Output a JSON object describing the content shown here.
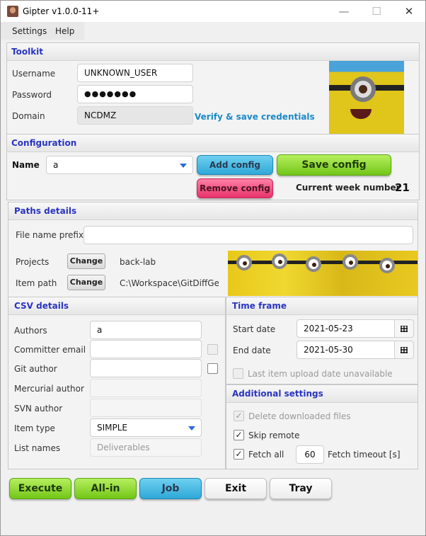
{
  "window": {
    "title": "Gipter v1.0.0-11+",
    "minimize": "—",
    "maximize": "☐",
    "close": "✕"
  },
  "menu": {
    "settings": "Settings",
    "help": "Help"
  },
  "toolkit": {
    "header": "Toolkit",
    "username_label": "Username",
    "username_value": "UNKNOWN_USER",
    "password_label": "Password",
    "password_value": "●●●●●●●",
    "domain_label": "Domain",
    "domain_value": "NCDMZ",
    "verify_link": "Verify & save credentials"
  },
  "configuration": {
    "header": "Configuration",
    "name_label": "Name",
    "name_value": "a",
    "add_config": "Add config",
    "save_config": "Save config",
    "remove_config": "Remove config",
    "week_label": "Current week number",
    "week_value": "21"
  },
  "paths": {
    "header": "Paths details",
    "prefix_label": "File name prefix",
    "prefix_value": "",
    "projects_label": "Projects",
    "projects_button": "Change",
    "projects_value": "back-lab",
    "item_path_label": "Item path",
    "item_path_button": "Change",
    "item_path_value": "C:\\Workspace\\GitDiffGe..."
  },
  "csv": {
    "header": "CSV details",
    "authors_label": "Authors",
    "authors_value": "a",
    "committer_email_label": "Committer email",
    "committer_email_value": "",
    "git_author_label": "Git author",
    "git_author_value": "",
    "mercurial_author_label": "Mercurial author",
    "mercurial_author_value": "",
    "svn_author_label": "SVN author",
    "svn_author_value": "",
    "item_type_label": "Item type",
    "item_type_value": "SIMPLE",
    "list_names_label": "List names",
    "list_names_value": "Deliverables"
  },
  "timeframe": {
    "header": "Time frame",
    "start_label": "Start date",
    "start_value": "2021-05-23",
    "end_label": "End date",
    "end_value": "2021-05-30",
    "last_upload_label": "Last item upload date unavailable"
  },
  "additional": {
    "header": "Additional settings",
    "delete_label": "Delete downloaded files",
    "skip_label": "Skip remote",
    "fetch_all_label": "Fetch all",
    "fetch_timeout_value": "60",
    "fetch_timeout_label": "Fetch timeout [s]"
  },
  "actions": {
    "execute": "Execute",
    "all_in": "All-in",
    "job": "Job",
    "exit": "Exit",
    "tray": "Tray"
  },
  "colors": {
    "header_text": "#2a35c0",
    "link": "#1c8ac8",
    "green": "#72c618",
    "blue": "#2fa8d8",
    "pink": "#e8336c"
  },
  "icons": {
    "check": "✓",
    "calendar": "calendar-icon"
  }
}
